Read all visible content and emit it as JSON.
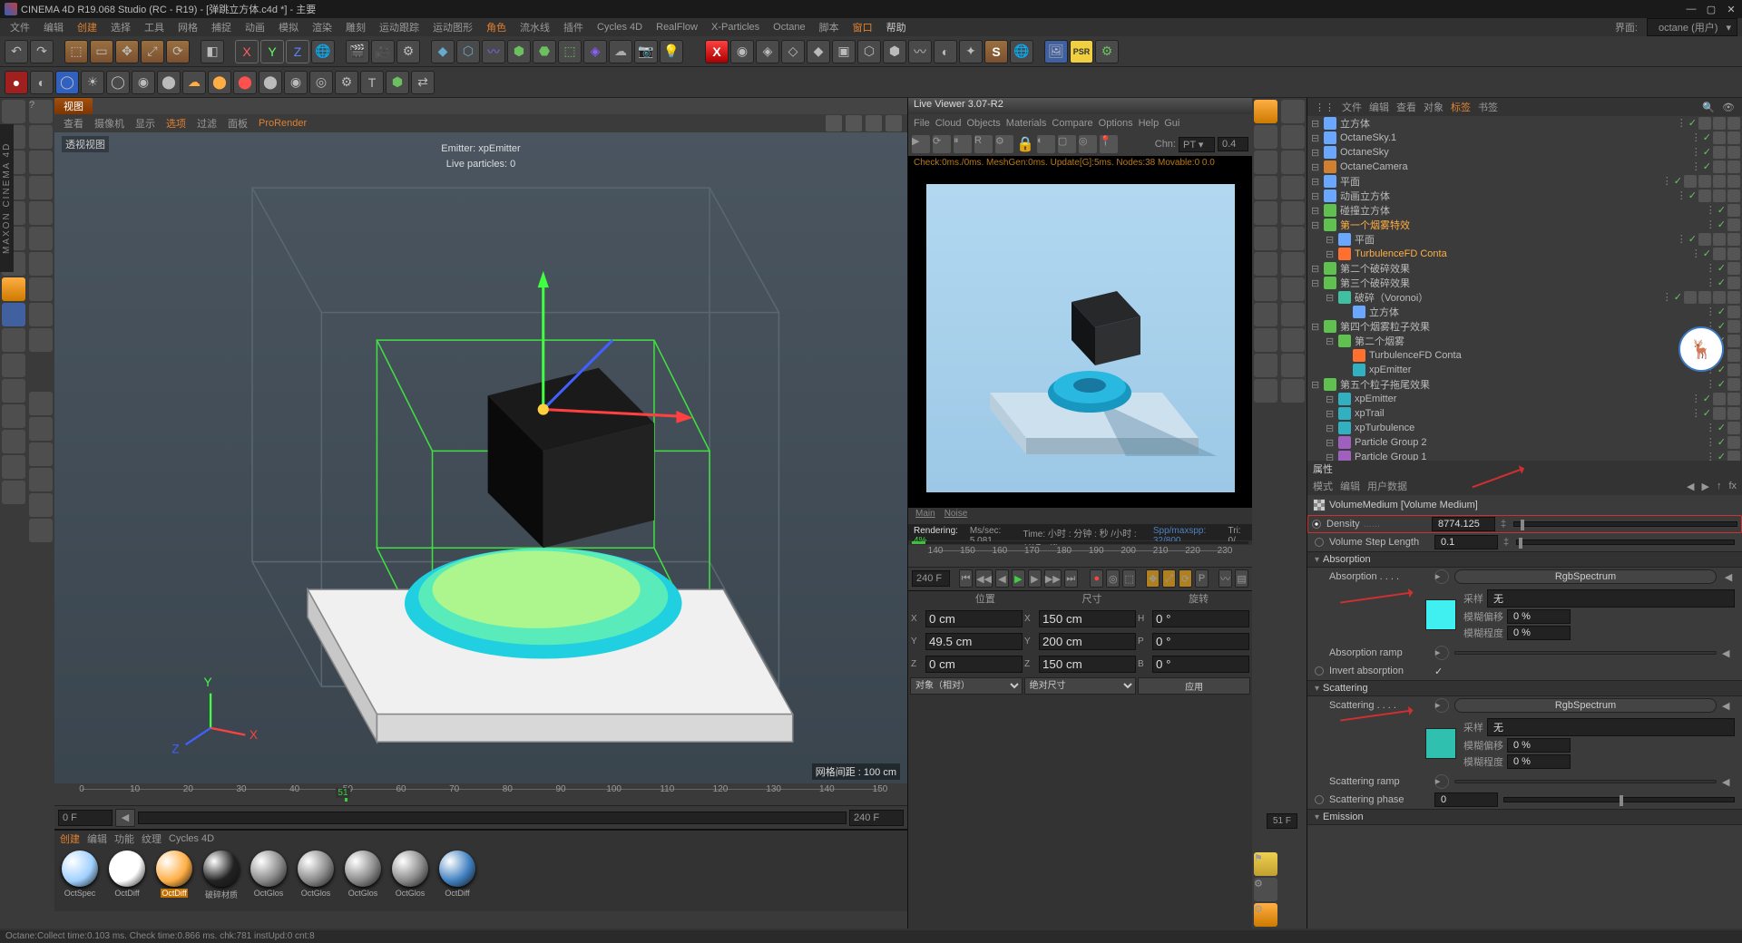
{
  "titlebar": {
    "title": "CINEMA 4D R19.068 Studio (RC - R19) - [弹跳立方体.c4d *] - 主要"
  },
  "menubar": {
    "items": [
      "文件",
      "编辑",
      "创建",
      "选择",
      "工具",
      "网格",
      "捕捉",
      "动画",
      "模拟",
      "渲染",
      "雕刻",
      "运动跟踪",
      "运动图形",
      "角色",
      "流水线",
      "插件",
      "Cycles 4D",
      "RealFlow",
      "X-Particles",
      "Octane",
      "脚本",
      "窗口",
      "帮助"
    ],
    "layout_label": "界面:",
    "layout_value": "octane (用户)"
  },
  "viewport": {
    "tab": "视图",
    "menus": [
      "查看",
      "摄像机",
      "显示",
      "选项",
      "过滤",
      "面板"
    ],
    "pro": "ProRender",
    "corner_label": "透视视图",
    "emitter_name": "Emitter: xpEmitter",
    "emitter_count": "Live particles: 0",
    "footer": "网格间距 : 100 cm"
  },
  "live_viewer": {
    "title": "Live Viewer 3.07-R2",
    "menus": [
      "File",
      "Cloud",
      "Objects",
      "Materials",
      "Compare",
      "Options",
      "Help",
      "Gui"
    ],
    "chn_label": "Chn:",
    "chn_value": "PT",
    "chn_num": "0.4",
    "status": "Check:0ms./0ms.  MeshGen:0ms. Update[G]:5ms. Nodes:38 Movable:0  0.0",
    "tabs": [
      "Main",
      "Noise"
    ],
    "footer_render": "Rendering: 4%",
    "footer_speed": "Ms/sec: 5.081",
    "footer_time": "Time: 小时 : 分钟 : 秒 /小时 : 分钟 : 秒",
    "footer_spp": "Spp/maxspp: 32/800",
    "footer_tri": "Tri: 0/"
  },
  "timeline": {
    "ticks": [
      "0",
      "10",
      "20",
      "30",
      "40",
      "50",
      "60",
      "70",
      "80",
      "90",
      "100",
      "110",
      "120",
      "130",
      "140",
      "150",
      "160",
      "170",
      "180",
      "190",
      "200",
      "210",
      "220",
      "230"
    ],
    "playhead": "51",
    "frame_start": "0 F",
    "frame_end": "240 F",
    "frame_end2": "240 F",
    "right_fps": "51 F"
  },
  "panels": {
    "top_tabs": [
      "文件",
      "编辑",
      "查看",
      "对象",
      "标签",
      "书签"
    ],
    "attr_header_tabs": [
      "模式",
      "编辑",
      "用户数据"
    ]
  },
  "objects": [
    {
      "ind": 0,
      "ico": "#6aa7ff",
      "name": "立方体",
      "tags": 3
    },
    {
      "ind": 0,
      "ico": "#6aa7ff",
      "name": "OctaneSky.1",
      "tags": 2
    },
    {
      "ind": 0,
      "ico": "#6aa7ff",
      "name": "OctaneSky",
      "tags": 2
    },
    {
      "ind": 0,
      "ico": "#d08030",
      "name": "OctaneCamera",
      "tags": 2
    },
    {
      "ind": 0,
      "ico": "#6aa7ff",
      "name": "平面",
      "tags": 4
    },
    {
      "ind": 0,
      "ico": "#6aa7ff",
      "name": "动画立方体",
      "tags": 3
    },
    {
      "ind": 0,
      "ico": "#60c050",
      "name": "碰撞立方体",
      "tags": 1
    },
    {
      "ind": 0,
      "ico": "#60c050",
      "name": "第一个烟雾特效",
      "sel": true,
      "tags": 1
    },
    {
      "ind": 1,
      "ico": "#6aa7ff",
      "name": "平面",
      "tags": 3
    },
    {
      "ind": 1,
      "ico": "#ff7030",
      "name": "TurbulenceFD Conta",
      "sel": true,
      "tags": 2
    },
    {
      "ind": 0,
      "ico": "#60c050",
      "name": "第二个破碎效果",
      "tags": 1
    },
    {
      "ind": 0,
      "ico": "#60c050",
      "name": "第三个破碎效果",
      "tags": 1
    },
    {
      "ind": 1,
      "ico": "#40c0a0",
      "name": "破碎（Voronoi）",
      "tags": 4
    },
    {
      "ind": 2,
      "ico": "#6aa7ff",
      "name": "立方体",
      "tags": 1
    },
    {
      "ind": 0,
      "ico": "#60c050",
      "name": "第四个烟雾粒子效果",
      "tags": 1
    },
    {
      "ind": 1,
      "ico": "#60c050",
      "name": "第二个烟雾",
      "tags": 1
    },
    {
      "ind": 2,
      "ico": "#ff7030",
      "name": "TurbulenceFD Conta",
      "tags": 1
    },
    {
      "ind": 2,
      "ico": "#30b0c0",
      "name": "xpEmitter",
      "tags": 1
    },
    {
      "ind": 0,
      "ico": "#60c050",
      "name": "第五个粒子拖尾效果",
      "tags": 1
    },
    {
      "ind": 1,
      "ico": "#30b0c0",
      "name": "xpEmitter",
      "tags": 2
    },
    {
      "ind": 1,
      "ico": "#30b0c0",
      "name": "xpTrail",
      "tags": 2
    },
    {
      "ind": 1,
      "ico": "#30b0c0",
      "name": "xpTurbulence",
      "tags": 1
    },
    {
      "ind": 1,
      "ico": "#a060c0",
      "name": "Particle Group 2",
      "tags": 1
    },
    {
      "ind": 1,
      "ico": "#a060c0",
      "name": "Particle Group 1",
      "tags": 1
    }
  ],
  "attributes": {
    "tab_title": "属性",
    "object_label": "VolumeMedium [Volume Medium]",
    "density_label": "Density",
    "density_value": "8774.125",
    "step_label": "Volume Step Length",
    "step_value": "0.1",
    "absorption_head": "Absorption",
    "absorption_label": "Absorption",
    "rgbspec": "RgbSpectrum",
    "sample_label": "采样",
    "sample_value": "无",
    "blur_offset_label": "模糊偏移",
    "blur_offset_value": "0 %",
    "blur_degree_label": "模糊程度",
    "blur_degree_value": "0 %",
    "ramp_label": "Absorption ramp",
    "invert_label": "Invert absorption",
    "scattering_head": "Scattering",
    "scattering_label": "Scattering",
    "scat_ramp_label": "Scattering ramp",
    "scat_phase_label": "Scattering phase",
    "scat_phase_value": "0",
    "emission_head": "Emission"
  },
  "materials": {
    "tabs": [
      "创建",
      "编辑",
      "功能",
      "纹理",
      "Cycles 4D"
    ],
    "items": [
      "OctSpec",
      "OctDiff",
      "OctDiff",
      "破碎材质",
      "OctGlos",
      "OctGlos",
      "OctGlos",
      "OctGlos",
      "OctDiff"
    ]
  },
  "coords": {
    "headers": [
      "位置",
      "尺寸",
      "旋转"
    ],
    "rows": [
      {
        "axis": "X",
        "pos": "0 cm",
        "size": "150 cm",
        "rot": "H",
        "rotv": "0 °"
      },
      {
        "axis": "Y",
        "pos": "49.5 cm",
        "size": "200 cm",
        "rot": "P",
        "rotv": "0 °"
      },
      {
        "axis": "Z",
        "pos": "0 cm",
        "size": "150 cm",
        "rot": "B",
        "rotv": "0 °"
      }
    ],
    "mode1": "对象（相对）",
    "mode2": "绝对尺寸",
    "apply": "应用"
  },
  "statusbar": "Octane:Collect time:0.103 ms.  Check time:0.866 ms.  chk:781  instUpd:0  cnt:8",
  "side_label": "MAXON CINEMA 4D"
}
